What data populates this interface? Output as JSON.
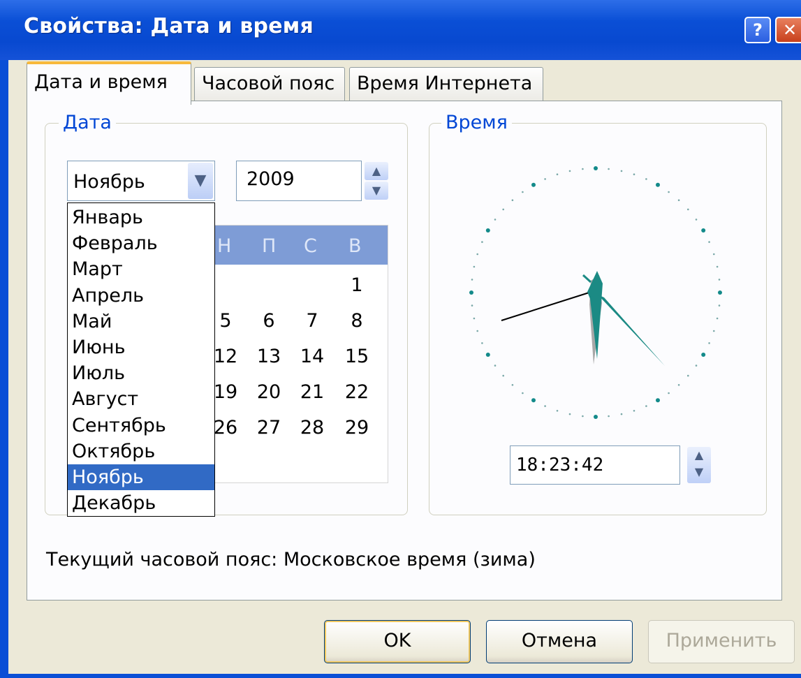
{
  "window": {
    "title": "Свойства: Дата и время",
    "help_label": "?",
    "close_label": "✕"
  },
  "tabs": [
    {
      "label": "Дата и время",
      "active": true
    },
    {
      "label": "Часовой пояс",
      "active": false
    },
    {
      "label": "Время Интернета",
      "active": false
    }
  ],
  "date_group": {
    "label": "Дата",
    "month_selected": "Ноябрь",
    "year": "2009",
    "months": [
      "Январь",
      "Февраль",
      "Март",
      "Апрель",
      "Май",
      "Июнь",
      "Июль",
      "Август",
      "Сентябрь",
      "Октябрь",
      "Ноябрь",
      "Декабрь"
    ],
    "calendar": {
      "day_headers_visible": [
        "Н",
        "П",
        "С",
        "В"
      ],
      "rows": [
        [
          "",
          "",
          "",
          "1"
        ],
        [
          "5",
          "6",
          "7",
          "8"
        ],
        [
          "12",
          "13",
          "14",
          "15"
        ],
        [
          "19",
          "20",
          "21",
          "22"
        ],
        [
          "26",
          "27",
          "28",
          "29"
        ]
      ]
    }
  },
  "time_group": {
    "label": "Время",
    "time_value": "18:23:42"
  },
  "timezone_text": "Текущий часовой пояс: Московское время (зима)",
  "buttons": {
    "ok": "OK",
    "cancel": "Отмена",
    "apply": "Применить"
  },
  "icons": {
    "dropdown": "chevron-down-icon",
    "spin": "spin-arrows-icon"
  },
  "colors": {
    "titlebar": "#0a4fd6",
    "selection": "#316ac5",
    "clock_hands": "#1b8a84",
    "calendar_header": "#7e9cd6"
  }
}
